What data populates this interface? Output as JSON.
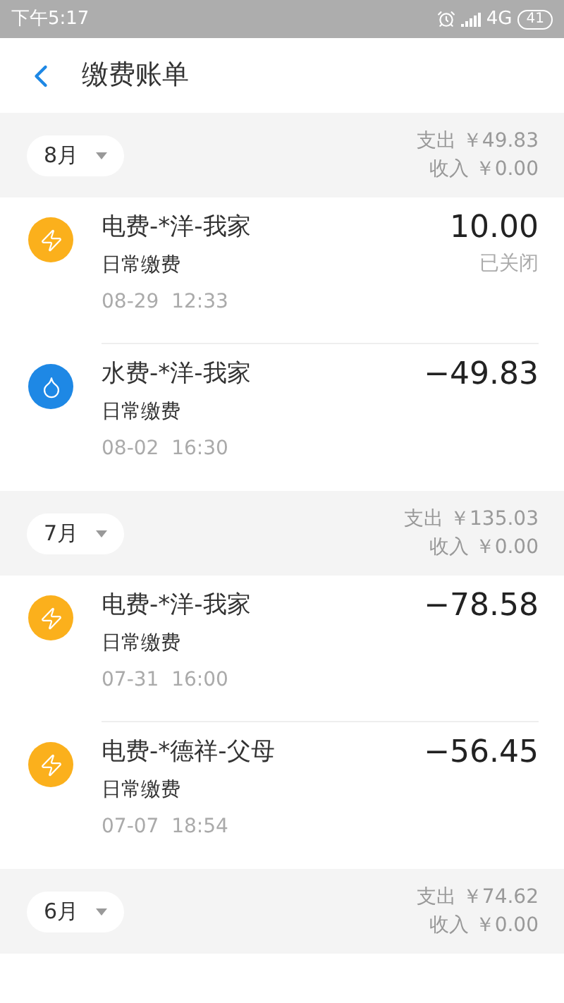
{
  "status_bar": {
    "time": "下午5:17",
    "network": "4G",
    "battery": "41"
  },
  "header": {
    "title": "缴费账单"
  },
  "months": [
    {
      "month": "8月",
      "expense": "支出 ￥49.83",
      "income": "收入 ￥0.00",
      "bills": [
        {
          "kind": "electric",
          "title": "电费-*洋-我家",
          "category": "日常缴费",
          "time": "08-29  12:33",
          "amount": "10.00",
          "status": "已关闭"
        },
        {
          "kind": "water",
          "title": "水费-*洋-我家",
          "category": "日常缴费",
          "time": "08-02  16:30",
          "amount": "−49.83"
        }
      ]
    },
    {
      "month": "7月",
      "expense": "支出 ￥135.03",
      "income": "收入 ￥0.00",
      "bills": [
        {
          "kind": "electric",
          "title": "电费-*洋-我家",
          "category": "日常缴费",
          "time": "07-31  16:00",
          "amount": "−78.58"
        },
        {
          "kind": "electric",
          "title": "电费-*德祥-父母",
          "category": "日常缴费",
          "time": "07-07  18:54",
          "amount": "−56.45"
        }
      ]
    },
    {
      "month": "6月",
      "expense": "支出 ￥74.62",
      "income": "收入 ￥0.00"
    }
  ]
}
